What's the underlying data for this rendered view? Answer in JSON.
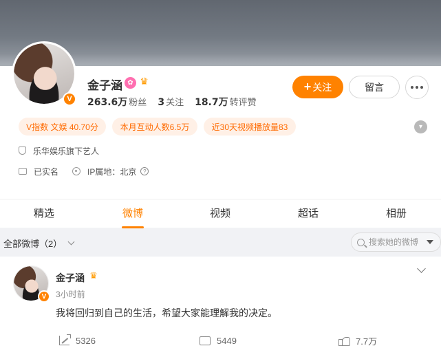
{
  "profile": {
    "name": "金子涵",
    "verified_badge": "V",
    "stats": [
      {
        "value": "263.6万",
        "label": "粉丝"
      },
      {
        "value": "3",
        "label": "关注"
      },
      {
        "value": "18.7万",
        "label": "转评赞"
      }
    ],
    "follow_label": "关注",
    "message_label": "留言",
    "tags": [
      "V指数 文娱 40.70分",
      "本月互动人数6.5万",
      "近30天视频播放量83"
    ],
    "agency": "乐华娱乐旗下艺人",
    "realname": "已实名",
    "ip_location": "IP属地：北京"
  },
  "tabs": [
    "精选",
    "微博",
    "视频",
    "超话",
    "相册"
  ],
  "active_tab": "微博",
  "filter": {
    "label": "全部微博（2）",
    "search_placeholder": "搜索她的微博"
  },
  "post": {
    "author": "金子涵",
    "time": "3小时前",
    "text": "我将回归到自己的生活，希望大家能理解我的决定。",
    "forwards": "5326",
    "comments": "5449",
    "likes": "7.7万"
  },
  "colors": {
    "accent": "#ff8200",
    "tag_bg": "#fff0e6",
    "page_bg": "#f1f2f5"
  }
}
